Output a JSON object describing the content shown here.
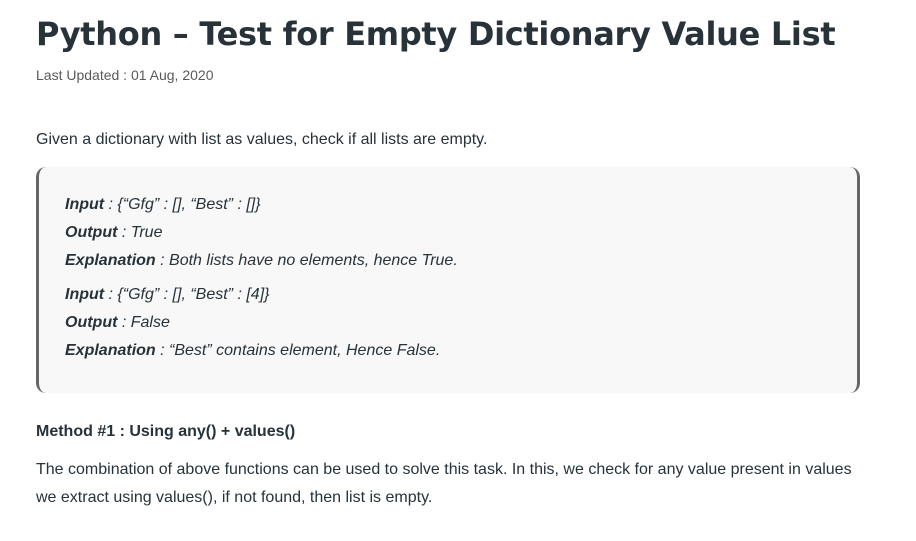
{
  "article": {
    "title": "Python – Test for Empty Dictionary Value List",
    "last_updated_label": "Last Updated : ",
    "last_updated_date": "01 Aug, 2020",
    "intro": "Given a dictionary with list as values, check if all lists are empty.",
    "examples": [
      {
        "input_key": "Input",
        "input_value": " : {“Gfg” : [], “Best” : []}",
        "output_key": "Output",
        "output_value": " : True",
        "explanation_key": "Explanation",
        "explanation_value": " : Both lists have no elements, hence True."
      },
      {
        "input_key": "Input",
        "input_value": " : {“Gfg” : [], “Best” : [4]}",
        "output_key": "Output",
        "output_value": " : False",
        "explanation_key": "Explanation",
        "explanation_value": " : “Best” contains element, Hence False."
      }
    ],
    "method_heading": "Method #1 : Using any() + values()",
    "method_description": "The combination of above functions can be used to solve this  task. In this, we check for any value present in values we extract using values(), if not found, then list is empty."
  }
}
